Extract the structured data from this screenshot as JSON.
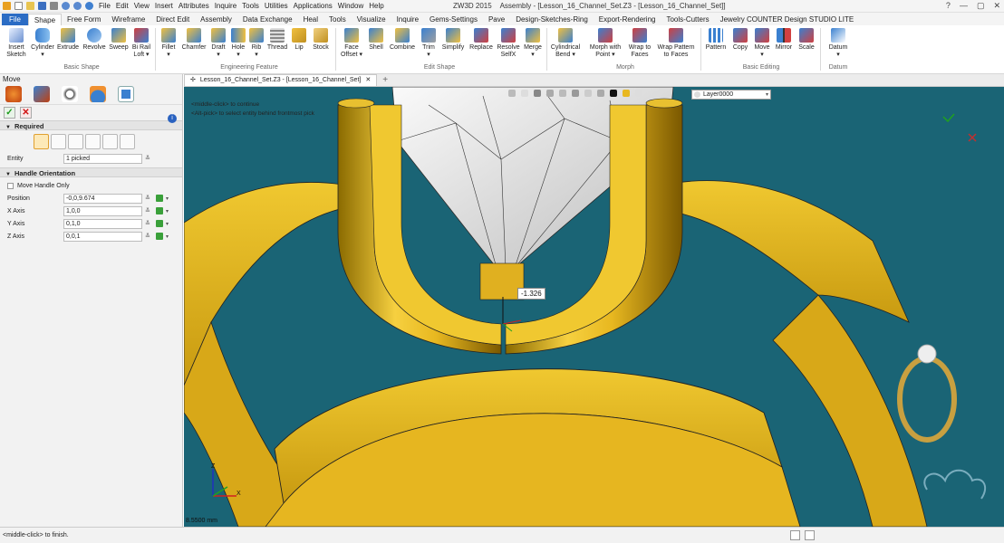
{
  "menubar": {
    "items": [
      "File",
      "Edit",
      "View",
      "Insert",
      "Attributes",
      "Inquire",
      "Tools",
      "Utilities",
      "Applications",
      "Window",
      "Help"
    ]
  },
  "window": {
    "app_version": "ZW3D 2015",
    "title": "Assembly - [Lesson_16_Channel_Set.Z3 - [Lesson_16_Channel_Set]]"
  },
  "tabs": [
    "File",
    "Shape",
    "Free Form",
    "Wireframe",
    "Direct Edit",
    "Assembly",
    "Data Exchange",
    "Heal",
    "Tools",
    "Visualize",
    "Inquire",
    "Gems-Settings",
    "Pave",
    "Design-Sketches-Ring",
    "Export-Rendering",
    "Tools-Cutters",
    "Jewelry COUNTER Design STUDIO LITE"
  ],
  "ribbon": {
    "groups": {
      "basic_shape": "Basic Shape",
      "engineering_feature": "Engineering Feature",
      "edit_shape": "Edit Shape",
      "morph": "Morph",
      "basic_editing": "Basic Editing",
      "datum": "Datum"
    },
    "buttons": [
      {
        "l1": "Insert",
        "l2": "Sketch"
      },
      {
        "l1": "Cylinder",
        "l2": "▾"
      },
      {
        "l1": "Extrude",
        "l2": ""
      },
      {
        "l1": "Revolve",
        "l2": ""
      },
      {
        "l1": "Sweep",
        "l2": ""
      },
      {
        "l1": "Bi Rail",
        "l2": "Loft ▾"
      },
      {
        "l1": "Fillet",
        "l2": "▾"
      },
      {
        "l1": "Chamfer",
        "l2": ""
      },
      {
        "l1": "Draft",
        "l2": "▾"
      },
      {
        "l1": "Hole",
        "l2": "▾"
      },
      {
        "l1": "Rib",
        "l2": "▾"
      },
      {
        "l1": "Thread",
        "l2": ""
      },
      {
        "l1": "Lip",
        "l2": ""
      },
      {
        "l1": "Stock",
        "l2": ""
      },
      {
        "l1": "Face",
        "l2": "Offset ▾"
      },
      {
        "l1": "Shell",
        "l2": ""
      },
      {
        "l1": "Combine",
        "l2": ""
      },
      {
        "l1": "Trim",
        "l2": "▾"
      },
      {
        "l1": "Simplify",
        "l2": ""
      },
      {
        "l1": "Replace",
        "l2": ""
      },
      {
        "l1": "Resolve",
        "l2": "SelfX"
      },
      {
        "l1": "Merge",
        "l2": "▾"
      },
      {
        "l1": "Cylindrical",
        "l2": "Bend ▾"
      },
      {
        "l1": "Morph with",
        "l2": "Point ▾"
      },
      {
        "l1": "Wrap to",
        "l2": "Faces"
      },
      {
        "l1": "Wrap Pattern",
        "l2": "to Faces"
      },
      {
        "l1": "Pattern",
        "l2": ""
      },
      {
        "l1": "Copy",
        "l2": ""
      },
      {
        "l1": "Move",
        "l2": "▾"
      },
      {
        "l1": "Mirror",
        "l2": ""
      },
      {
        "l1": "Scale",
        "l2": ""
      },
      {
        "l1": "Datum",
        "l2": "▾"
      }
    ]
  },
  "panel": {
    "title": "Move",
    "required": "Required",
    "entity_label": "Entity",
    "entity_value": "1 picked",
    "handle_orientation": "Handle Orientation",
    "move_handle_only": "Move Handle Only",
    "fields": [
      {
        "label": "Position",
        "value": "-0,0,9.674"
      },
      {
        "label": "X Axis",
        "value": "1,0,0"
      },
      {
        "label": "Y Axis",
        "value": "0,1,0"
      },
      {
        "label": "Z Axis",
        "value": "0,0,1"
      }
    ]
  },
  "document_tab": "Lesson_16_Channel_Set.Z3 - [Lesson_16_Channel_Set]",
  "viewport": {
    "hint1": "<middle-click> to continue",
    "hint2": "<Alt-pick> to select entity behind frontmost pick",
    "dimension": "-1.326",
    "layer": "Layer0000",
    "scale": "8.5500 mm",
    "axis_z": "Z",
    "axis_x": "X"
  },
  "status": {
    "text": "<middle-click> to finish."
  },
  "colors": {
    "viewport_bg": "#1a6475",
    "gold": "#e8b820",
    "ribbon_accent": "#2b6cc4"
  }
}
